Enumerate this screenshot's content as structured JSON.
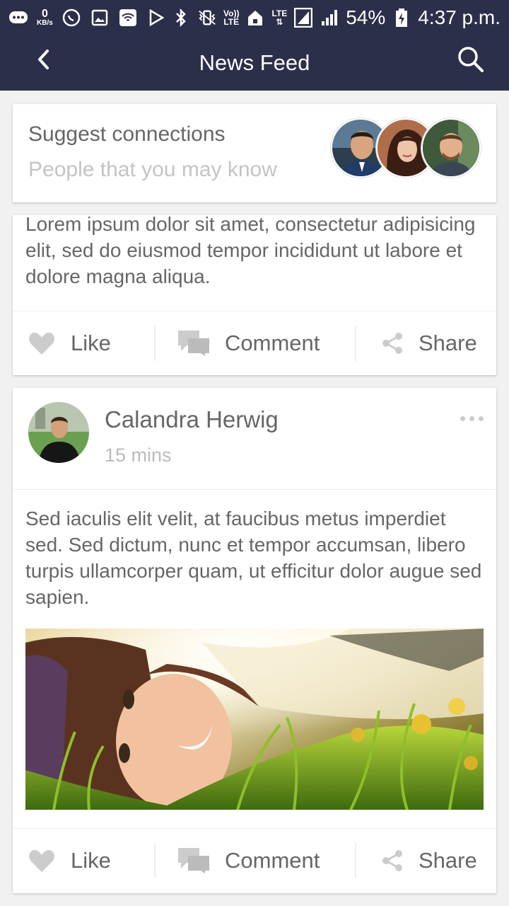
{
  "status_bar": {
    "data_speed": "0",
    "data_unit": "KB/s",
    "volte_top": "Vo))",
    "volte_bottom": "LTE",
    "lte": "LTE",
    "battery": "54%",
    "time": "4:37 p.m."
  },
  "app_bar": {
    "title": "News Feed",
    "back_icon": "chevron-left-icon",
    "search_icon": "search-icon"
  },
  "suggest": {
    "title": "Suggest connections",
    "subtitle": "People that you may know",
    "avatar_count": 3
  },
  "posts": [
    {
      "text": "Lorem ipsum dolor sit amet, consectetur adipisicing elit, sed do eiusmod tempor incididunt ut labore et dolore magna aliqua.",
      "actions": {
        "like": "Like",
        "comment": "Comment",
        "share": "Share"
      }
    },
    {
      "author": "Calandra Herwig",
      "time": "15 mins",
      "text": "Sed iaculis elit velit, at faucibus metus imperdiet sed. Sed dictum, nunc et tempor accumsan, libero turpis ullamcorper quam, ut efficitur dolor augue sed sapien.",
      "actions": {
        "like": "Like",
        "comment": "Comment",
        "share": "Share"
      }
    }
  ],
  "colors": {
    "app_bar": "#2b2f4a",
    "background": "#f1f1f1",
    "card": "#ffffff",
    "text": "#666666",
    "muted_text": "#c4c4c4",
    "icon": "#cccccc"
  }
}
